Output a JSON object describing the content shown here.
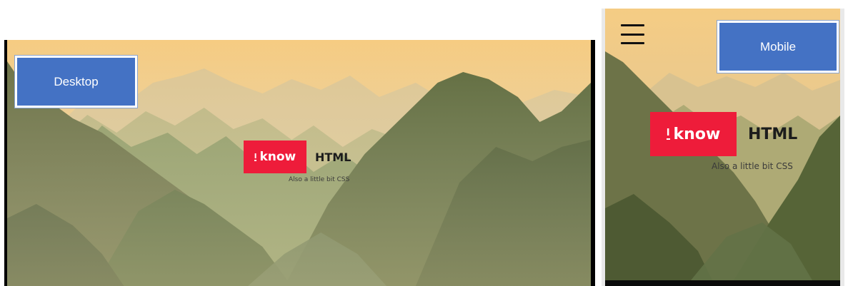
{
  "callouts": {
    "desktop": "Desktop",
    "mobile": "Mobile"
  },
  "logo": {
    "badge_mark": "I",
    "badge_word": "know",
    "heading": "HTML",
    "tagline": "Also a little bit CSS"
  },
  "colors": {
    "badge": "#ee1c3a",
    "callout": "#4472c4",
    "sky": "#f6cd83"
  },
  "icons": {
    "menu": "hamburger-menu-icon"
  }
}
